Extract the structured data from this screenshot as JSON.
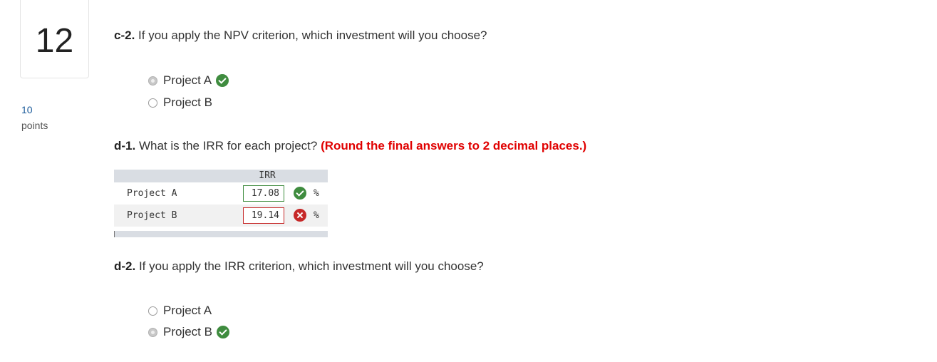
{
  "question": {
    "number": "12",
    "points_value": "10",
    "points_label": "points"
  },
  "c2": {
    "label": "c-2.",
    "text": " If you apply the NPV criterion, which investment will you choose?",
    "options": [
      {
        "label": "Project A",
        "selected": true,
        "status": "correct"
      },
      {
        "label": "Project B",
        "selected": false
      }
    ]
  },
  "d1": {
    "label": "d-1.",
    "text": " What is the IRR for each project? ",
    "instruction": "(Round the final answers to 2 decimal places.)",
    "table": {
      "column_header": "IRR",
      "rows": [
        {
          "label": "Project A",
          "value": "17.08",
          "unit": "%",
          "status": "correct"
        },
        {
          "label": "Project B",
          "value": "19.14",
          "unit": "%",
          "status": "incorrect"
        }
      ]
    }
  },
  "d2": {
    "label": "d-2.",
    "text": " If you apply the IRR criterion, which investment will you choose?",
    "options": [
      {
        "label": "Project A",
        "selected": false
      },
      {
        "label": "Project B",
        "selected": true,
        "status": "correct"
      }
    ]
  },
  "colors": {
    "correct": "#3f8c3f",
    "incorrect": "#c62828",
    "instruction": "#e00000",
    "points": "#1a5a9a"
  },
  "icons": {
    "correct": "check-circle-icon",
    "incorrect": "x-circle-icon"
  }
}
